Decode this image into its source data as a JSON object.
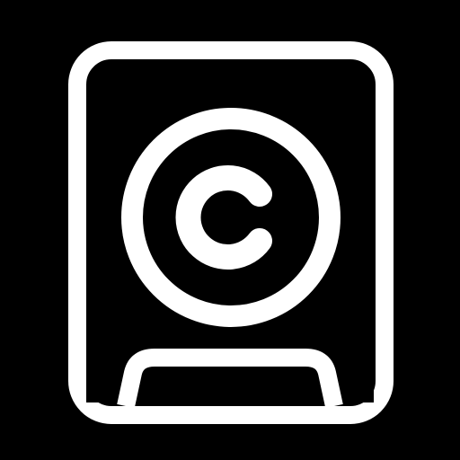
{
  "icon": {
    "name": "copyright-document-icon",
    "symbol": "copyright-icon",
    "colors": {
      "background": "#000000",
      "foreground": "#ffffff"
    }
  }
}
